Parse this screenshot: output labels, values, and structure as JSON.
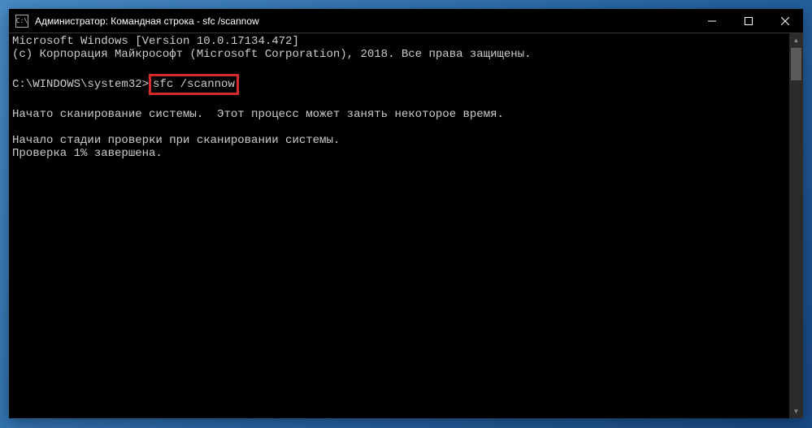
{
  "titlebar": {
    "icon_text": "C:\\",
    "title": "Администратор: Командная строка - sfc  /scannow"
  },
  "console": {
    "line1": "Microsoft Windows [Version 10.0.17134.472]",
    "line2": "(c) Корпорация Майкрософт (Microsoft Corporation), 2018. Все права защищены.",
    "blank1": "",
    "prompt": "C:\\WINDOWS\\system32>",
    "command": "sfc /scannow",
    "blank2": "",
    "line5": "Начато сканирование системы.  Этот процесс может занять некоторое время.",
    "blank3": "",
    "line7": "Начало стадии проверки при сканировании системы.",
    "line8": "Проверка 1% завершена."
  }
}
